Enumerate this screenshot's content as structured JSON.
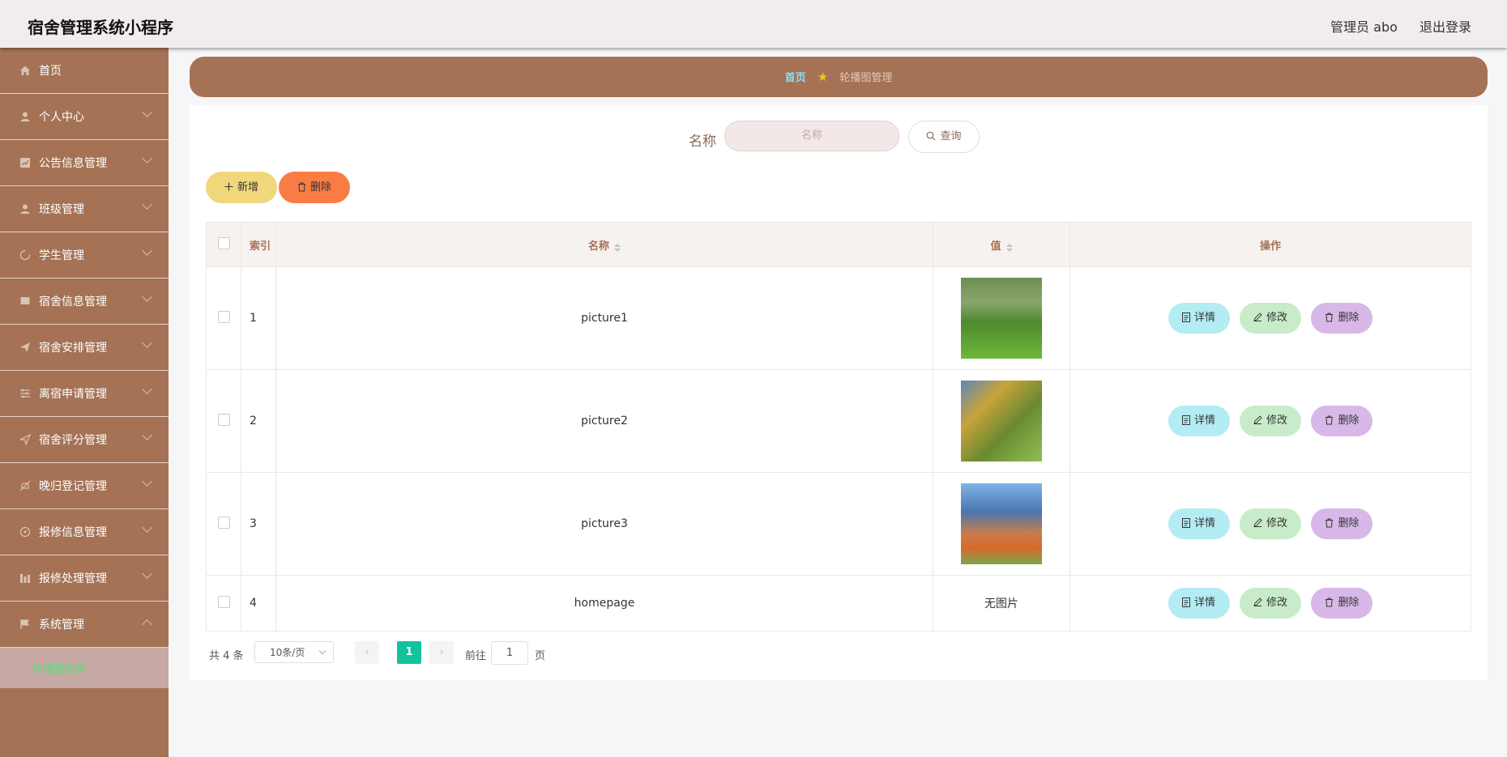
{
  "header": {
    "title": "宿舍管理系统小程序",
    "user": "管理员 abo",
    "logout": "退出登录"
  },
  "sidebar": {
    "items": [
      {
        "label": "首页",
        "icon": "home-icon"
      },
      {
        "label": "个人中心",
        "icon": "user-icon"
      },
      {
        "label": "公告信息管理",
        "icon": "chart-icon"
      },
      {
        "label": "班级管理",
        "icon": "user-icon"
      },
      {
        "label": "学生管理",
        "icon": "loading-icon"
      },
      {
        "label": "宿舍信息管理",
        "icon": "box-icon"
      },
      {
        "label": "宿舍安排管理",
        "icon": "send-icon"
      },
      {
        "label": "离宿申请管理",
        "icon": "sliders-icon"
      },
      {
        "label": "宿舍评分管理",
        "icon": "navigation-icon"
      },
      {
        "label": "晚归登记管理",
        "icon": "bell-off-icon"
      },
      {
        "label": "报修信息管理",
        "icon": "compass-icon"
      },
      {
        "label": "报修处理管理",
        "icon": "bar-chart-icon"
      },
      {
        "label": "系统管理",
        "icon": "flag-icon"
      }
    ],
    "sub_item": "轮播图管理"
  },
  "breadcrumb": {
    "home": "首页",
    "current": "轮播图管理"
  },
  "search": {
    "label": "名称",
    "placeholder": "名称",
    "button": "查询"
  },
  "actions": {
    "add": "新增",
    "delete": "删除"
  },
  "table": {
    "headers": {
      "index": "索引",
      "name": "名称",
      "value": "值",
      "ops": "操作"
    },
    "rows": [
      {
        "index": "1",
        "name": "picture1",
        "image": "park-lawn-photo"
      },
      {
        "index": "2",
        "name": "picture2",
        "image": "autumn-trees-photo"
      },
      {
        "index": "3",
        "name": "picture3",
        "image": "campus-garden-photo"
      },
      {
        "index": "4",
        "name": "homepage",
        "value_text": "无图片"
      }
    ],
    "row_buttons": {
      "detail": "详情",
      "edit": "修改",
      "delete": "删除"
    }
  },
  "pagination": {
    "total": "共 4 条",
    "page_size": "10条/页",
    "current_page": "1",
    "goto": "前往",
    "goto_value": "1",
    "unit": "页"
  },
  "colors": {
    "sidebar": "#a57255",
    "header": "#f3ecec",
    "accent_active": "#13c29d",
    "add": "#f0d77b",
    "delete": "#fa7c45"
  }
}
